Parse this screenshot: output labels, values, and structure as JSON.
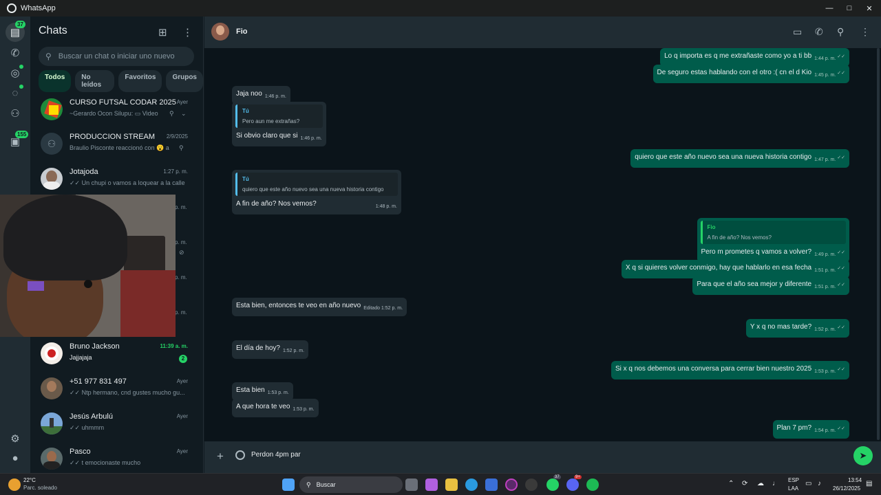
{
  "window": {
    "title": "WhatsApp",
    "minimize": "—",
    "maximize": "□",
    "close": "✕"
  },
  "rail": {
    "chats_badge": "37",
    "updates_badge": "155"
  },
  "sidebar": {
    "title": "Chats",
    "search_placeholder": "Buscar un chat o iniciar uno nuevo",
    "filters": [
      "Todos",
      "No leídos",
      "Favoritos",
      "Grupos"
    ],
    "chats": [
      {
        "name": "CURSO FUTSAL CODAR 2025",
        "time": "Ayer",
        "preview": "~Gerardo Ocon Silupu: ▭ Video"
      },
      {
        "name": "PRODUCCION STREAM",
        "time": "2/9/2025",
        "preview": "Braulio Pisconte reaccionó con 😮 a:"
      },
      {
        "name": "Jotajoda",
        "time": "1:27 p. m.",
        "preview": "✓✓ Un chupi o vamos a loquear a la calle"
      },
      {
        "name": "Bruno Jackson",
        "time": "11:39 a. m.",
        "preview": "Jajjajaja",
        "unread": "2"
      },
      {
        "name": "+51 977 831 497",
        "time": "Ayer",
        "preview": "✓✓ Ntp hermano, cnd gustes mucho gu..."
      },
      {
        "name": "Jesús Arbulú",
        "time": "Ayer",
        "preview": "✓✓ uhmmm"
      },
      {
        "name": "Pasco",
        "time": "Ayer",
        "preview": "✓✓ t emocionaste mucho"
      }
    ],
    "hidden_times": [
      "p. m.",
      "p. m.",
      "p. m.",
      "p. m."
    ]
  },
  "chat": {
    "contact": "Fio",
    "messages": [
      {
        "dir": "out",
        "text": "Lo q importa es q me extrañaste como yo a ti bb",
        "time": "1:44 p. m."
      },
      {
        "dir": "out",
        "text": "De seguro estas hablando con el otro :( cn el d Kio",
        "time": "1:45 p. m."
      },
      {
        "dir": "in",
        "text": "Jaja noo",
        "time": "1:46 p. m."
      },
      {
        "dir": "in",
        "quote_author": "Tú",
        "quote_text": "Pero aun me extrañas?",
        "text": "Si obvio claro que si",
        "time": "1:46 p. m."
      },
      {
        "dir": "out",
        "text": "quiero que este año nuevo sea una nueva historia contigo",
        "time": "1:47 p. m."
      },
      {
        "dir": "in",
        "quote_author": "Tú",
        "quote_text": "quiero que este año nuevo sea una nueva historia contigo",
        "text": "A fin de año? Nos vemos?",
        "time": "1:48 p. m."
      },
      {
        "dir": "out",
        "quote_author": "Fio",
        "quote_text": "A fin de año? Nos vemos?",
        "text": "Pero m prometes q vamos a volver?",
        "time": "1:49 p. m."
      },
      {
        "dir": "out",
        "text": "X q si quieres volver conmigo, hay que hablarlo en esa fecha",
        "time": "1:51 p. m."
      },
      {
        "dir": "out",
        "text": "Para que el año sea mejor y diferente",
        "time": "1:51 p. m."
      },
      {
        "dir": "in",
        "text": "Esta bien, entonces te veo en año nuevo",
        "time": "Editado 1:52 p. m."
      },
      {
        "dir": "out",
        "text": "Y x q no mas tarde?",
        "time": "1:52 p. m."
      },
      {
        "dir": "in",
        "text": "El día de hoy?",
        "time": "1:52 p. m."
      },
      {
        "dir": "out",
        "text": "Si x q nos debemos una conversa para cerrar bien nuestro 2025",
        "time": "1:53 p. m."
      },
      {
        "dir": "in",
        "text": "Esta bien",
        "time": "1:53 p. m."
      },
      {
        "dir": "in",
        "text": "A que hora te veo",
        "time": "1:53 p. m."
      },
      {
        "dir": "out",
        "text": "Plan 7 pm?",
        "time": "1:54 p. m."
      }
    ],
    "draft": "Perdon 4pm par"
  },
  "taskbar": {
    "weather_temp": "22°C",
    "weather_desc": "Parc. soleado",
    "search": "Buscar",
    "lang_top": "ESP",
    "lang_bottom": "LAA",
    "time": "13:54",
    "date": "26/12/2025",
    "whatsapp_badge": "37",
    "discord_badge": "9+"
  },
  "colors": {
    "accent": "#25d366",
    "outgoing": "#005c4b",
    "incoming": "#202c33",
    "background": "#0b141a"
  }
}
